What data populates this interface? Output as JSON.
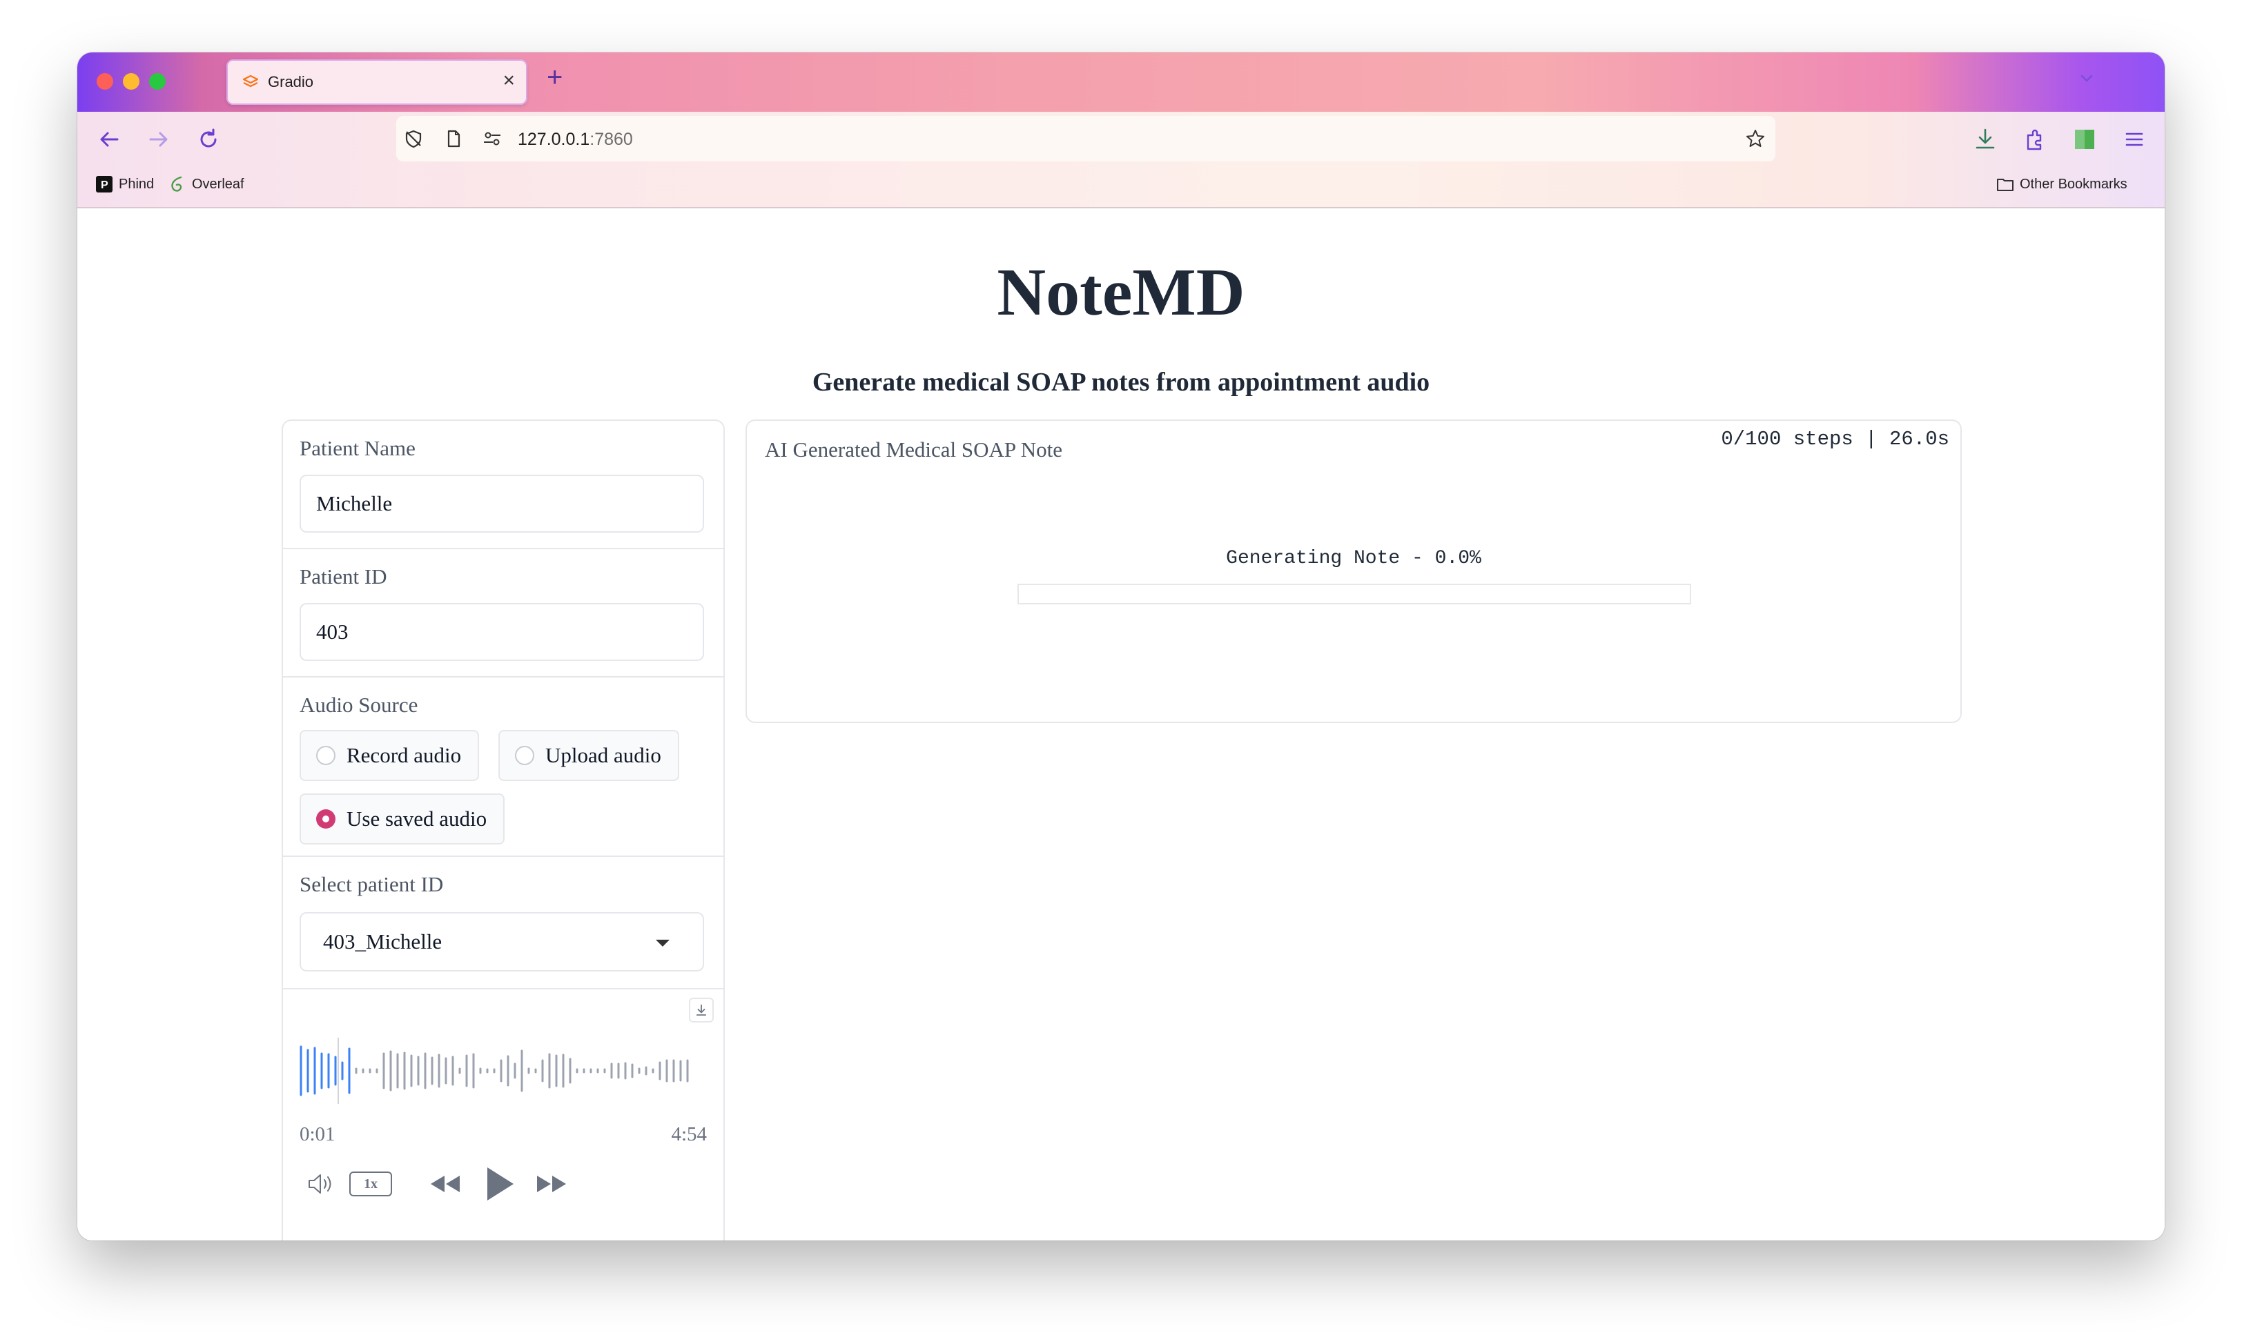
{
  "browser": {
    "tab_title": "Gradio",
    "tab_close": "×",
    "new_tab": "+",
    "url_host": "127.0.0.1",
    "url_port": ":7860",
    "bookmarks": [
      {
        "label": "Phind",
        "icon": "phind-icon"
      },
      {
        "label": "Overleaf",
        "icon": "overleaf-icon"
      }
    ],
    "other_bookmarks": "Other Bookmarks"
  },
  "app": {
    "title": "NoteMD",
    "subtitle": "Generate medical SOAP notes from appointment audio"
  },
  "form": {
    "patient_name": {
      "label": "Patient Name",
      "value": "Michelle"
    },
    "patient_id": {
      "label": "Patient ID",
      "value": "403"
    },
    "audio_source": {
      "label": "Audio Source",
      "options": [
        "Record audio",
        "Upload audio",
        "Use saved audio"
      ],
      "selected": "Use saved audio"
    },
    "select_patient": {
      "label": "Select patient ID",
      "value": "403_Michelle"
    }
  },
  "audio_player": {
    "current_time": "0:01",
    "duration": "4:54",
    "speed": "1x",
    "played_fraction": 0.004
  },
  "output": {
    "label": "AI Generated Medical SOAP Note",
    "steps_status": "0/100 steps | 26.0s",
    "generating_text": "Generating Note - 0.0%",
    "progress": 0.0
  },
  "colors": {
    "accent": "#d13b73",
    "waveform_played": "#3b82f6",
    "waveform": "#9ca3af"
  }
}
